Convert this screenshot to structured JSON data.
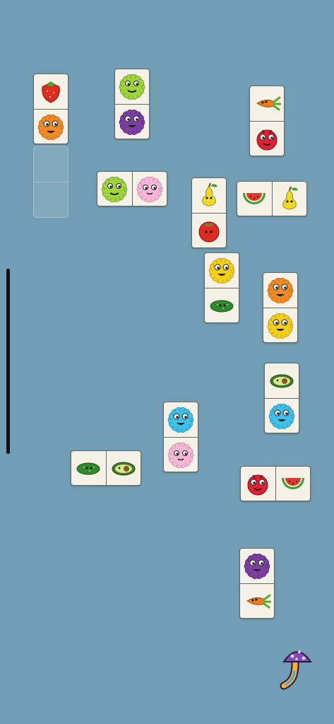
{
  "board": {
    "background": "#729eb5",
    "dominoes": [
      {
        "orientation": "v",
        "tiles": [
          "strawberry-icon",
          "orange-monster-icon"
        ]
      },
      {
        "orientation": "v",
        "tiles": [
          "green-monster-icon",
          "purple-monster-icon"
        ]
      },
      {
        "orientation": "v",
        "tiles": [
          "carrot-icon",
          "red-monster-icon"
        ]
      },
      {
        "orientation": "h",
        "tiles": [
          "green-monster-icon",
          "pink-monster-icon"
        ]
      },
      {
        "orientation": "v",
        "tiles": [
          "pear-icon",
          "tomato-icon"
        ]
      },
      {
        "orientation": "h",
        "tiles": [
          "watermelon-icon",
          "pear-icon"
        ]
      },
      {
        "orientation": "v",
        "tiles": [
          "yellow-monster-icon",
          "cucumber-icon"
        ]
      },
      {
        "orientation": "v",
        "tiles": [
          "orange-monster-icon",
          "yellow-monster-icon"
        ]
      },
      {
        "orientation": "v",
        "tiles": [
          "avocado-icon",
          "blue-monster-icon"
        ]
      },
      {
        "orientation": "v",
        "tiles": [
          "blue-monster-icon",
          "pink-monster-icon"
        ]
      },
      {
        "orientation": "h",
        "tiles": [
          "cucumber-icon",
          "avocado-icon"
        ]
      },
      {
        "orientation": "h",
        "tiles": [
          "red-monster-icon",
          "watermelon-icon"
        ]
      },
      {
        "orientation": "v",
        "tiles": [
          "purple-monster-icon",
          "carrot-icon"
        ]
      }
    ]
  },
  "controls": {
    "undo_icon": "mushroom-arrow-icon"
  }
}
